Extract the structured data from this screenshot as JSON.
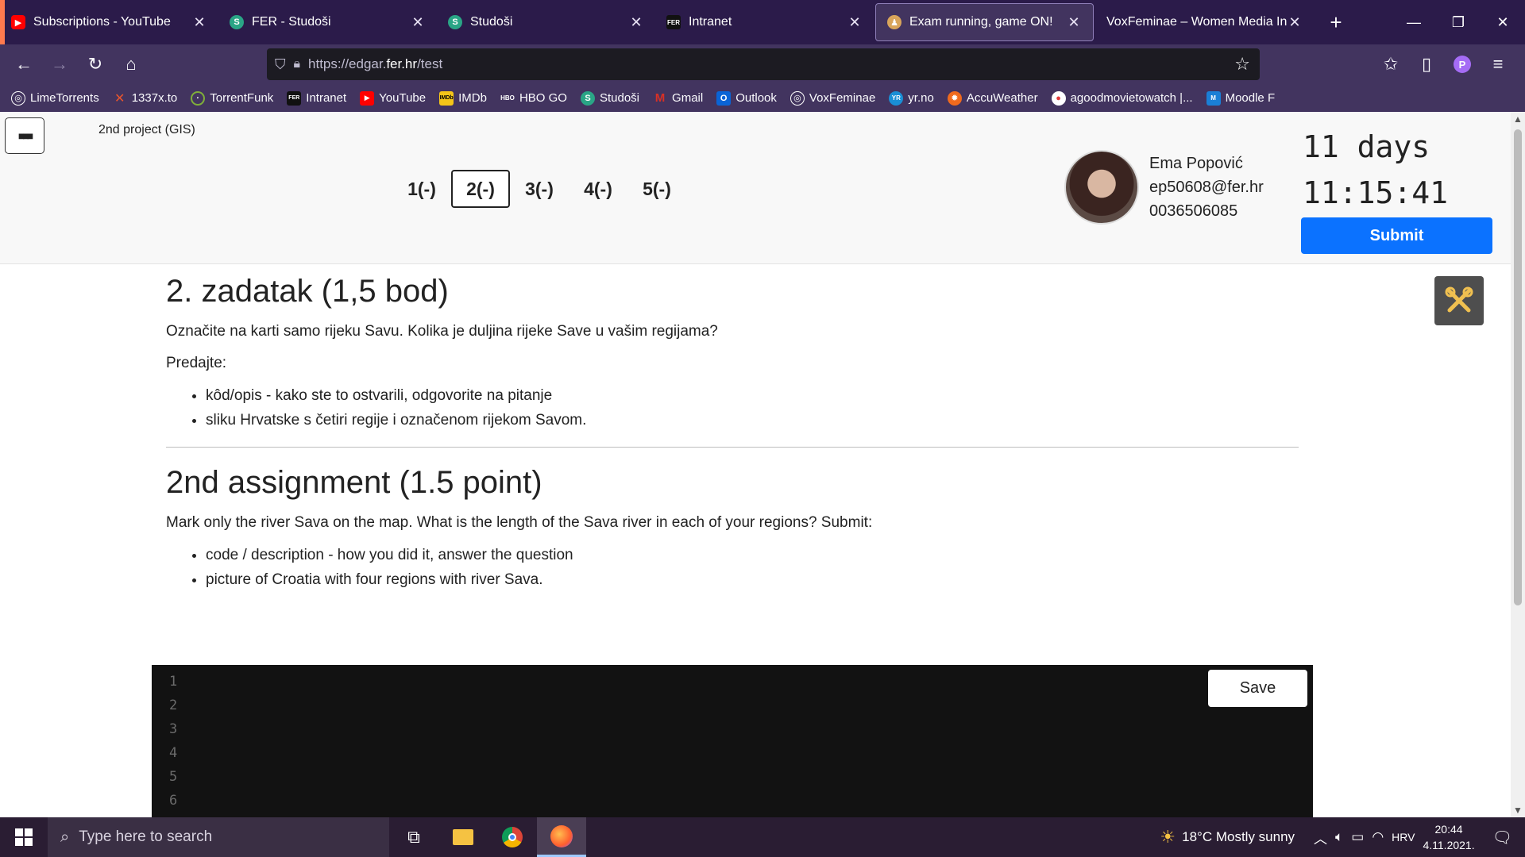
{
  "tabs": [
    {
      "title": "Subscriptions - YouTube",
      "favicon": "youtube-icon",
      "color": "#ff0000"
    },
    {
      "title": "FER - Studoši",
      "favicon": "studosi-icon",
      "color": "#2aa586"
    },
    {
      "title": "Studoši",
      "favicon": "studosi-icon",
      "color": "#2aa586"
    },
    {
      "title": "Intranet",
      "favicon": "fer-icon",
      "color": "#111111"
    },
    {
      "title": "Exam running, game ON!",
      "favicon": "edgar-icon",
      "color": "#d9a55b"
    },
    {
      "title": "VoxFeminae – Women Media Inde",
      "favicon": "",
      "color": ""
    }
  ],
  "url": {
    "prefix": "https://edgar.",
    "host": "fer.hr",
    "path": "/test"
  },
  "bookmarks": [
    {
      "label": "LimeTorrents",
      "color": "#8f7fb8"
    },
    {
      "label": "1337x.to",
      "color": "#e8552d"
    },
    {
      "label": "TorrentFunk",
      "color": "#7fae3a"
    },
    {
      "label": "Intranet",
      "color": "#111111"
    },
    {
      "label": "YouTube",
      "color": "#ff0000"
    },
    {
      "label": "IMDb",
      "color": "#f5c518"
    },
    {
      "label": "HBO GO",
      "color": "#444444"
    },
    {
      "label": "Studoši",
      "color": "#2aa586"
    },
    {
      "label": "Gmail",
      "color": "#d93025"
    },
    {
      "label": "Outlook",
      "color": "#0a64d6"
    },
    {
      "label": "VoxFeminae",
      "color": "#8f7fb8"
    },
    {
      "label": "yr.no",
      "color": "#1a8fd6"
    },
    {
      "label": "AccuWeather",
      "color": "#f06a1d"
    },
    {
      "label": "agoodmovietowatch |...",
      "color": "#e43b3b"
    },
    {
      "label": "Moodle F",
      "color": "#1a7fd6"
    }
  ],
  "project_title": "2nd project (GIS)",
  "questions": [
    "1(-)",
    "2(-)",
    "3(-)",
    "4(-)",
    "5(-)"
  ],
  "user": {
    "name": "Ema Popović",
    "email": "ep50608@fer.hr",
    "id": "0036506085"
  },
  "timer": {
    "days": "11 days",
    "time": "11:15:41"
  },
  "submit_label": "Submit",
  "task": {
    "hr_title": "2. zadatak (1,5 bod)",
    "hr_text": "Označite na karti samo rijeku Savu. Kolika je duljina rijeke Save u vašim regijama?",
    "hr_submit": "Predajte:",
    "hr_items": [
      "kôd/opis - kako ste to ostvarili, odgovorite na pitanje",
      "sliku Hrvatske s četiri regije i označenom rijekom Savom."
    ],
    "en_title": "2nd assignment (1.5 point)",
    "en_text": "Mark only the river Sava on the map. What is the length of the Sava river in each of your regions? Submit:",
    "en_items": [
      "code / description - how you did it, answer the question",
      "picture of Croatia with four regions with river Sava."
    ]
  },
  "editor": {
    "line_numbers": [
      "1",
      "2",
      "3",
      "4",
      "5",
      "6"
    ],
    "save_label": "Save"
  },
  "taskbar": {
    "search_placeholder": "Type here to search",
    "weather": "18°C  Mostly sunny",
    "lang": "HRV",
    "time": "20:44",
    "date": "4.11.2021."
  }
}
